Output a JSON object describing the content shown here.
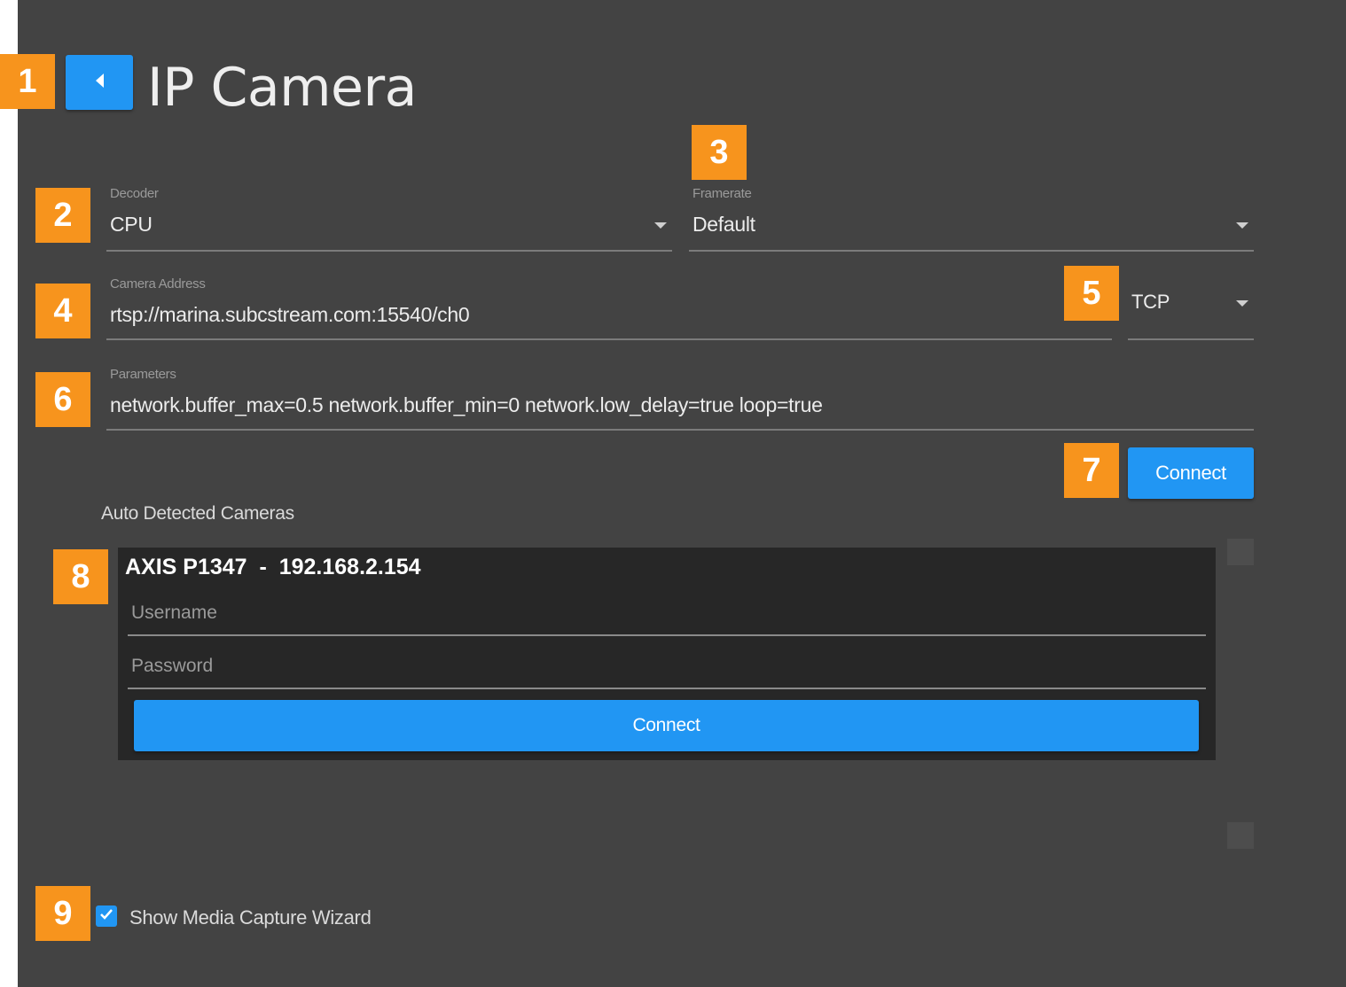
{
  "header": {
    "title": "IP Camera",
    "back_icon": "caret-left-icon"
  },
  "form": {
    "decoder": {
      "label": "Decoder",
      "value": "CPU"
    },
    "framerate": {
      "label": "Framerate",
      "value": "Default"
    },
    "camera_address": {
      "label": "Camera Address",
      "value": "rtsp://marina.subcstream.com:15540/ch0"
    },
    "protocol": {
      "value": "TCP"
    },
    "parameters": {
      "label": "Parameters",
      "value": "network.buffer_max=0.5 network.buffer_min=0 network.low_delay=true loop=true"
    },
    "connect_label": "Connect"
  },
  "auto_detected": {
    "label": "Auto Detected Cameras",
    "cameras": [
      {
        "title": "AXIS P1347  -  192.168.2.154",
        "username_placeholder": "Username",
        "password_placeholder": "Password",
        "connect_label": "Connect"
      }
    ]
  },
  "footer": {
    "show_wizard_label": "Show Media Capture Wizard",
    "show_wizard_checked": true
  },
  "markers": [
    "1",
    "2",
    "3",
    "4",
    "5",
    "6",
    "7",
    "8",
    "9"
  ],
  "colors": {
    "background": "#434343",
    "card": "#272727",
    "accent": "#2196f3",
    "marker": "#f7941d"
  }
}
